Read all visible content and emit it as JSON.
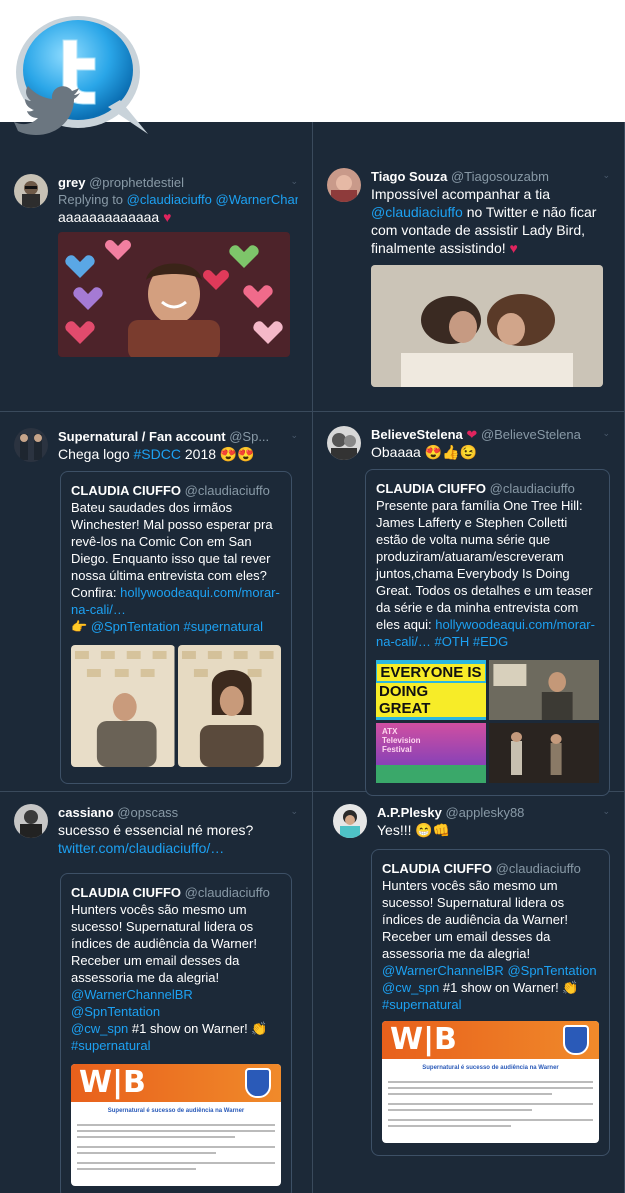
{
  "header": {
    "logo": "twitter-bird-logo"
  },
  "tweets": [
    {
      "name": "grey",
      "handle": "@prophetdestiel",
      "reply_prefix": "Replying to",
      "reply_to": "@claudiaciuffo @WarnerChann...",
      "text": "aaaaaaaaaaaaa",
      "emoji": "♥",
      "media_desc": "smiling-man-gif"
    },
    {
      "name": "Tiago Souza",
      "handle": "@Tiagosouzabm",
      "text_a": "Impossível acompanhar a tia",
      "mention": "@claudiaciuffo",
      "text_b": "no Twitter e não ficar com vontade de assistir Lady Bird, finalmente assistindo!",
      "emoji": "♥"
    },
    {
      "name": "Supernatural / Fan account",
      "handle": "@Sp...",
      "text_a": "Chega logo",
      "hashtag": "#SDCC",
      "text_b": "2018",
      "emoji": "😍😍",
      "quote": {
        "name": "CLAUDIA CIUFFO",
        "handle": "@claudiaciuffo",
        "text": "Bateu saudades dos irmãos Winchester! Mal posso esperar pra revê-los na Comic Con em San Diego. Enquanto isso que tal rever nossa última entrevista com eles? Confira:",
        "link": "hollywoodeaqui.com/morar-na-cali/…",
        "pointer": "👉",
        "mention": "@SpnTentation",
        "hashtag": "#supernatural"
      }
    },
    {
      "name": "BelieveStelena",
      "handle": "@BelieveStelena",
      "text": "Obaaaa",
      "emoji": "😍👍😉",
      "quote": {
        "name": "CLAUDIA CIUFFO",
        "handle": "@claudiaciuffo",
        "text": "Presente para família One Tree Hill: James Lafferty e Stephen Colletti estão de volta numa série que produziram/atuaram/escreveram juntos,chama Everybody Is Doing Great. Todos os detalhes e um teaser da série e da minha entrevista com eles aqui:",
        "link": "hollywoodeaqui.com/morar-na-cali/…",
        "hashtag1": "#OTH",
        "hashtag2": "#EDG",
        "poster_line1": "EVERYONE IS",
        "poster_line2": "DOING GREAT",
        "festival_line1": "ATX",
        "festival_line2": "Television",
        "festival_line3": "Festival"
      }
    },
    {
      "name": "cassiano",
      "handle": "@opscass",
      "text": "sucesso é essencial né mores?",
      "link": "twitter.com/claudiaciuffo/…",
      "quote": {
        "name": "CLAUDIA CIUFFO",
        "handle": "@claudiaciuffo",
        "text": "Hunters vocês são mesmo um sucesso! Supernatural lidera os índices de audiência da Warner! Receber um email desses da assessoria me da alegria!",
        "mention1": "@WarnerChannelBR",
        "mention2": "@SpnTentation",
        "mention3": "@cw_spn",
        "text2": "#1 show on Warner!",
        "clap": "👏",
        "hashtag": "#supernatural",
        "doc_title": "Supernatural é sucesso de audiência na Warner"
      }
    },
    {
      "name": "A.P.Plesky",
      "handle": "@applesky88",
      "text": "Yes!!!",
      "emoji": "😁👊",
      "quote": {
        "name": "CLAUDIA CIUFFO",
        "handle": "@claudiaciuffo",
        "text": "Hunters vocês são mesmo um sucesso! Supernatural lidera os índices de audiência da Warner! Receber um email desses da assessoria me da alegria!",
        "mention1": "@WarnerChannelBR",
        "mention2": "@SpnTentation",
        "mention3": "@cw_spn",
        "text2": "#1 show on Warner!",
        "clap": "👏",
        "hashtag": "#supernatural",
        "doc_title": "Supernatural é sucesso de audiência na Warner"
      }
    }
  ]
}
